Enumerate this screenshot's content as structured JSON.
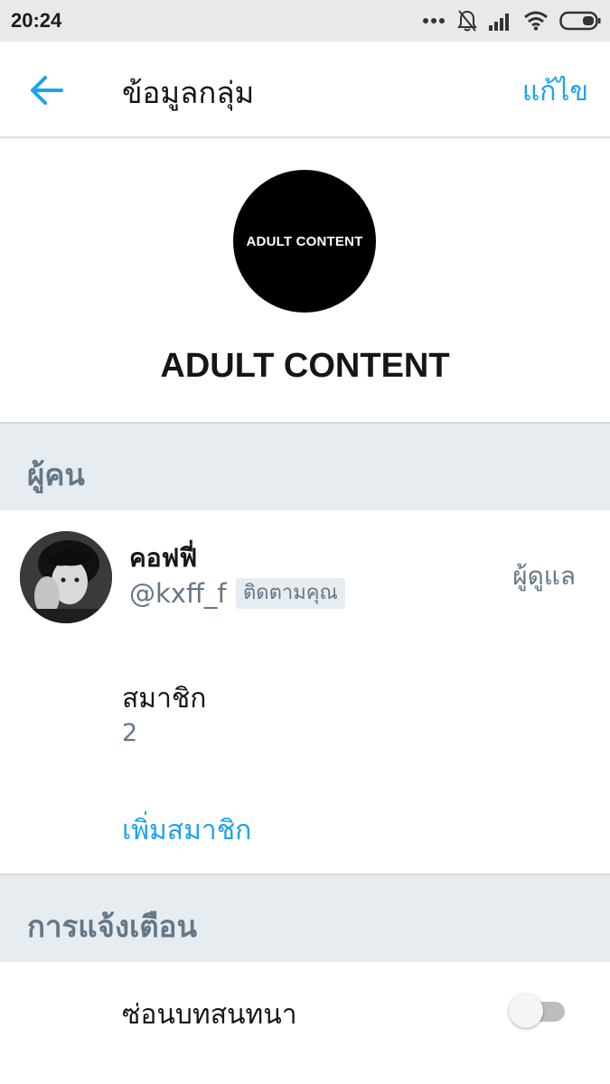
{
  "status_bar": {
    "time": "20:24",
    "icons": [
      "more-dots-icon",
      "notifications-off-icon",
      "signal-icon",
      "wifi-icon",
      "battery-icon"
    ]
  },
  "app_bar": {
    "back_icon": "arrow-left-icon",
    "title": "ข้อมูลกลุ่ม",
    "edit_label": "แก้ไข"
  },
  "group": {
    "avatar_text": "ADULT CONTENT",
    "name": "ADULT CONTENT"
  },
  "people_section": {
    "title": "ผู้คน",
    "member": {
      "name": "คอฟฟี่",
      "handle": "@kxff_f",
      "badge": "ติดตามคุณ",
      "role": "ผู้ดูแล"
    },
    "members_label": "สมาชิก",
    "members_count": "2",
    "add_member_label": "เพิ่มสมาชิก"
  },
  "notifications_section": {
    "title": "การแจ้งเตือน",
    "hide_conversation_label": "ซ่อนบทสนทนา",
    "hide_conversation_on": false
  },
  "colors": {
    "accent": "#1da1f2",
    "section_bg": "#e6ecf0",
    "secondary_text": "#657786",
    "primary_text": "#14171a"
  }
}
